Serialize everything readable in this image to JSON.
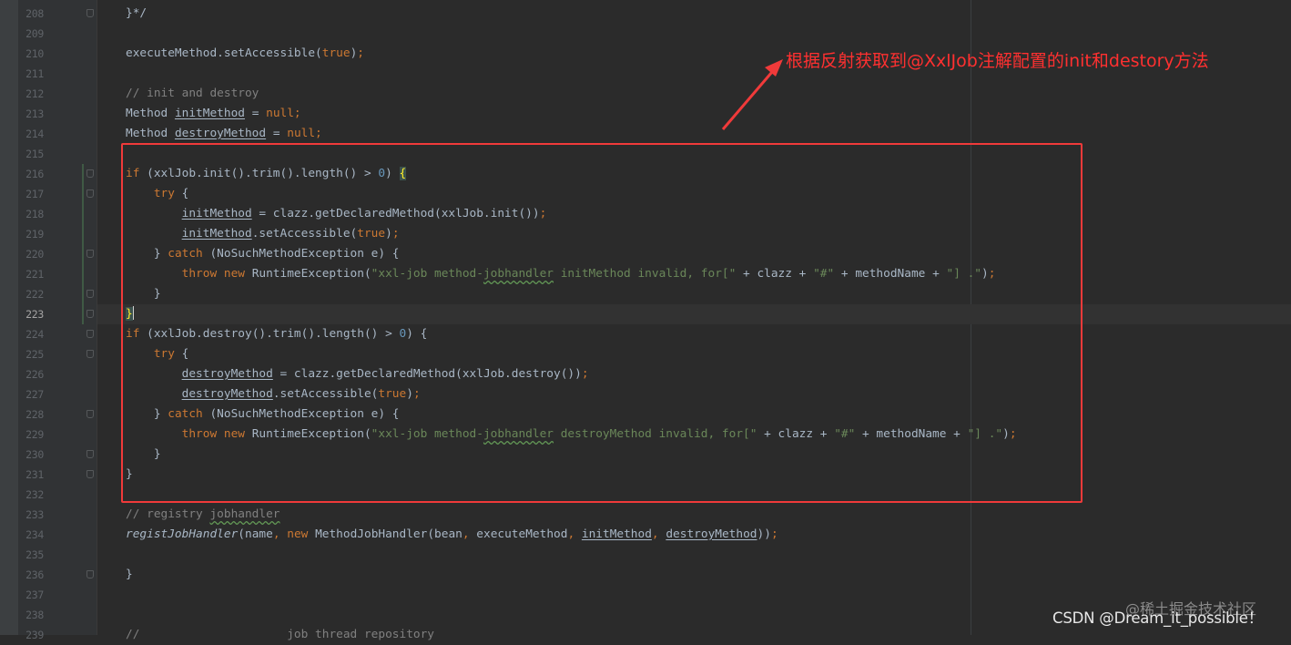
{
  "annotation_text": "根据反射获取到@XxlJob注解配置的init和destory方法",
  "watermark": {
    "csdn": "CSDN @Dream_it_possible！",
    "juejin": "@稀土掘金技术社区"
  },
  "editor": {
    "current_line": "223",
    "lines": [
      {
        "no": "208",
        "fold": true,
        "segs": [
          {
            "t": "}*/"
          }
        ]
      },
      {
        "no": "209",
        "fold": false,
        "segs": []
      },
      {
        "no": "210",
        "fold": false,
        "segs": [
          {
            "t": "executeMethod.setAccessible("
          },
          {
            "t": "true",
            "c": "kw"
          },
          {
            "t": ")"
          },
          {
            "t": ";",
            "c": "kw"
          }
        ]
      },
      {
        "no": "211",
        "fold": false,
        "segs": []
      },
      {
        "no": "212",
        "fold": false,
        "segs": [
          {
            "t": "// init and destroy",
            "c": "cm"
          }
        ]
      },
      {
        "no": "213",
        "fold": false,
        "segs": [
          {
            "t": "Method "
          },
          {
            "t": "initMethod",
            "c": "ul"
          },
          {
            "t": " = "
          },
          {
            "t": "null;",
            "c": "kw"
          }
        ]
      },
      {
        "no": "214",
        "fold": false,
        "segs": [
          {
            "t": "Method "
          },
          {
            "t": "destroyMethod",
            "c": "ul"
          },
          {
            "t": " = "
          },
          {
            "t": "null;",
            "c": "kw"
          }
        ]
      },
      {
        "no": "215",
        "fold": false,
        "segs": []
      },
      {
        "no": "216",
        "fold": true,
        "segs": [
          {
            "t": "if ",
            "c": "kw"
          },
          {
            "t": "(xxlJob.init().trim().length() > "
          },
          {
            "t": "0",
            "c": "num"
          },
          {
            "t": ") "
          },
          {
            "t": "{",
            "c": "brace"
          }
        ]
      },
      {
        "no": "217",
        "fold": true,
        "segs": [
          {
            "t": "    "
          },
          {
            "t": "try ",
            "c": "kw"
          },
          {
            "t": "{"
          }
        ]
      },
      {
        "no": "218",
        "fold": false,
        "segs": [
          {
            "t": "        "
          },
          {
            "t": "initMethod",
            "c": "ul"
          },
          {
            "t": " = clazz.getDeclaredMethod(xxlJob.init())"
          },
          {
            "t": ";",
            "c": "kw"
          }
        ]
      },
      {
        "no": "219",
        "fold": false,
        "segs": [
          {
            "t": "        "
          },
          {
            "t": "initMethod",
            "c": "ul"
          },
          {
            "t": ".setAccessible("
          },
          {
            "t": "true",
            "c": "kw"
          },
          {
            "t": ")"
          },
          {
            "t": ";",
            "c": "kw"
          }
        ]
      },
      {
        "no": "220",
        "fold": true,
        "segs": [
          {
            "t": "    } "
          },
          {
            "t": "catch ",
            "c": "kw"
          },
          {
            "t": "(NoSuchMethodException e) {"
          }
        ]
      },
      {
        "no": "221",
        "fold": false,
        "segs": [
          {
            "t": "        "
          },
          {
            "t": "throw new ",
            "c": "kw"
          },
          {
            "t": "RuntimeException("
          },
          {
            "t": "\"xxl-job method-",
            "c": "str"
          },
          {
            "t": "jobhandler",
            "c": "str typo"
          },
          {
            "t": " initMethod invalid, for[\"",
            "c": "str"
          },
          {
            "t": " + clazz + "
          },
          {
            "t": "\"#\"",
            "c": "str"
          },
          {
            "t": " + methodName + "
          },
          {
            "t": "\"] .\"",
            "c": "str"
          },
          {
            "t": ")"
          },
          {
            "t": ";",
            "c": "kw"
          }
        ]
      },
      {
        "no": "222",
        "fold": true,
        "segs": [
          {
            "t": "    }"
          }
        ]
      },
      {
        "no": "223",
        "fold": true,
        "segs": [
          {
            "t": "}",
            "c": "brace"
          },
          {
            "t": "",
            "c": "caret"
          }
        ]
      },
      {
        "no": "224",
        "fold": true,
        "segs": [
          {
            "t": "if ",
            "c": "kw"
          },
          {
            "t": "(xxlJob.destroy().trim().length() > "
          },
          {
            "t": "0",
            "c": "num"
          },
          {
            "t": ") {"
          }
        ]
      },
      {
        "no": "225",
        "fold": true,
        "segs": [
          {
            "t": "    "
          },
          {
            "t": "try ",
            "c": "kw"
          },
          {
            "t": "{"
          }
        ]
      },
      {
        "no": "226",
        "fold": false,
        "segs": [
          {
            "t": "        "
          },
          {
            "t": "destroyMethod",
            "c": "ul"
          },
          {
            "t": " = clazz.getDeclaredMethod(xxlJob.destroy())"
          },
          {
            "t": ";",
            "c": "kw"
          }
        ]
      },
      {
        "no": "227",
        "fold": false,
        "segs": [
          {
            "t": "        "
          },
          {
            "t": "destroyMethod",
            "c": "ul"
          },
          {
            "t": ".setAccessible("
          },
          {
            "t": "true",
            "c": "kw"
          },
          {
            "t": ")"
          },
          {
            "t": ";",
            "c": "kw"
          }
        ]
      },
      {
        "no": "228",
        "fold": true,
        "segs": [
          {
            "t": "    } "
          },
          {
            "t": "catch ",
            "c": "kw"
          },
          {
            "t": "(NoSuchMethodException e) {"
          }
        ]
      },
      {
        "no": "229",
        "fold": false,
        "segs": [
          {
            "t": "        "
          },
          {
            "t": "throw new ",
            "c": "kw"
          },
          {
            "t": "RuntimeException("
          },
          {
            "t": "\"xxl-job method-",
            "c": "str"
          },
          {
            "t": "jobhandler",
            "c": "str typo"
          },
          {
            "t": " destroyMethod invalid, for[\"",
            "c": "str"
          },
          {
            "t": " + clazz + "
          },
          {
            "t": "\"#\"",
            "c": "str"
          },
          {
            "t": " + methodName + "
          },
          {
            "t": "\"] .\"",
            "c": "str"
          },
          {
            "t": ")"
          },
          {
            "t": ";",
            "c": "kw"
          }
        ]
      },
      {
        "no": "230",
        "fold": true,
        "segs": [
          {
            "t": "    }"
          }
        ]
      },
      {
        "no": "231",
        "fold": true,
        "segs": [
          {
            "t": "}"
          }
        ]
      },
      {
        "no": "232",
        "fold": false,
        "segs": []
      },
      {
        "no": "233",
        "fold": false,
        "segs": [
          {
            "t": "// registry ",
            "c": "cm"
          },
          {
            "t": "jobhandler",
            "c": "cm typo"
          }
        ]
      },
      {
        "no": "234",
        "fold": false,
        "segs": [
          {
            "t": "registJobHandler",
            "c": "fn"
          },
          {
            "t": "(name"
          },
          {
            "t": ", ",
            "c": "kw"
          },
          {
            "t": "new ",
            "c": "kw"
          },
          {
            "t": "MethodJobHandler(bean"
          },
          {
            "t": ", ",
            "c": "kw"
          },
          {
            "t": "executeMethod"
          },
          {
            "t": ", ",
            "c": "kw"
          },
          {
            "t": "initMethod",
            "c": "ul"
          },
          {
            "t": ", ",
            "c": "kw"
          },
          {
            "t": "destroyMethod",
            "c": "ul"
          },
          {
            "t": "))"
          },
          {
            "t": ";",
            "c": "kw"
          }
        ]
      },
      {
        "no": "235",
        "fold": false,
        "segs": []
      },
      {
        "no": "236",
        "fold": true,
        "segs": [
          {
            "t": "}"
          }
        ]
      },
      {
        "no": "237",
        "fold": false,
        "segs": []
      },
      {
        "no": "238",
        "fold": false,
        "segs": []
      },
      {
        "no": "239",
        "fold": false,
        "segs": [
          {
            "t": "// ",
            "c": "cm"
          },
          {
            "t": "                    ",
            "c": "cm"
          },
          {
            "t": "job thread repository",
            "c": "cm"
          }
        ]
      }
    ]
  }
}
